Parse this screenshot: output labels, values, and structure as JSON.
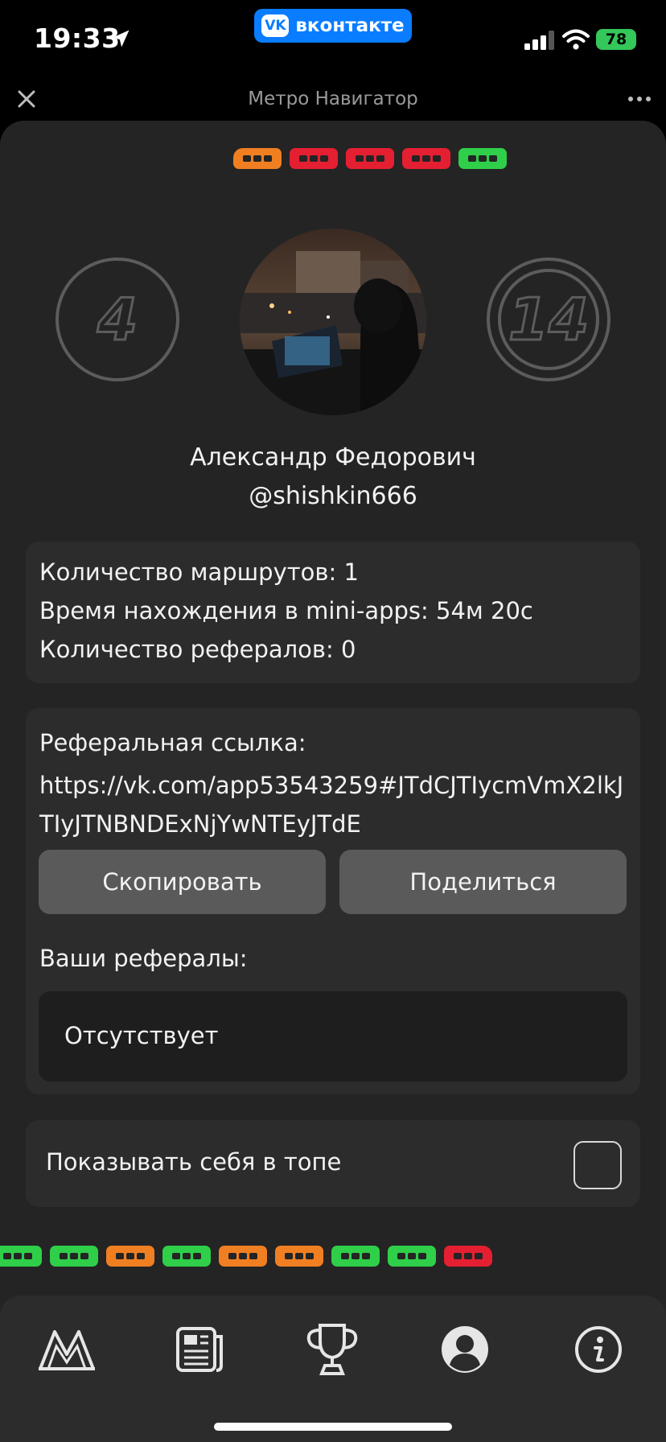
{
  "status_bar": {
    "time": "19:33",
    "battery": "78",
    "location_icon": "location-arrow-icon",
    "signal_icon": "cellular-signal-icon",
    "wifi_icon": "wifi-icon",
    "battery_color": "#34c759"
  },
  "host_app": {
    "logo": "VK",
    "label": "вконтакте",
    "color": "#0a7cff"
  },
  "header": {
    "title": "Метро Навигатор",
    "close_icon": "close-icon",
    "more_icon": "more-dots-icon"
  },
  "profile": {
    "name": "Александр Федорович",
    "handle": "@shishkin666",
    "left_badge": "4",
    "right_badge": "14",
    "avatar_icon": "avatar-photo"
  },
  "stats": [
    "Количество маршрутов: 1",
    "Время нахождения в mini-apps: 54м 20с",
    "Количество рефералов: 0"
  ],
  "referral": {
    "title": "Реферальная ссылка:",
    "link": "https://vk.com/app53543259#JTdCJTIycmVmX2lkJTIyJTNBNDExNjYwNTEyJTdE",
    "copy_label": "Скопировать",
    "share_label": "Поделиться",
    "list_title": "Ваши рефералы:",
    "empty_label": "Отсутствует"
  },
  "top_toggle": {
    "label": "Показывать себя в топе",
    "checked": false
  },
  "colors": {
    "orange": "#f07f22",
    "red": "#e51f32",
    "green": "#2fcf4a"
  },
  "nav": {
    "items": [
      "metro-icon",
      "news-icon",
      "trophy-icon",
      "profile-icon",
      "info-icon"
    ],
    "active": "profile-icon"
  }
}
